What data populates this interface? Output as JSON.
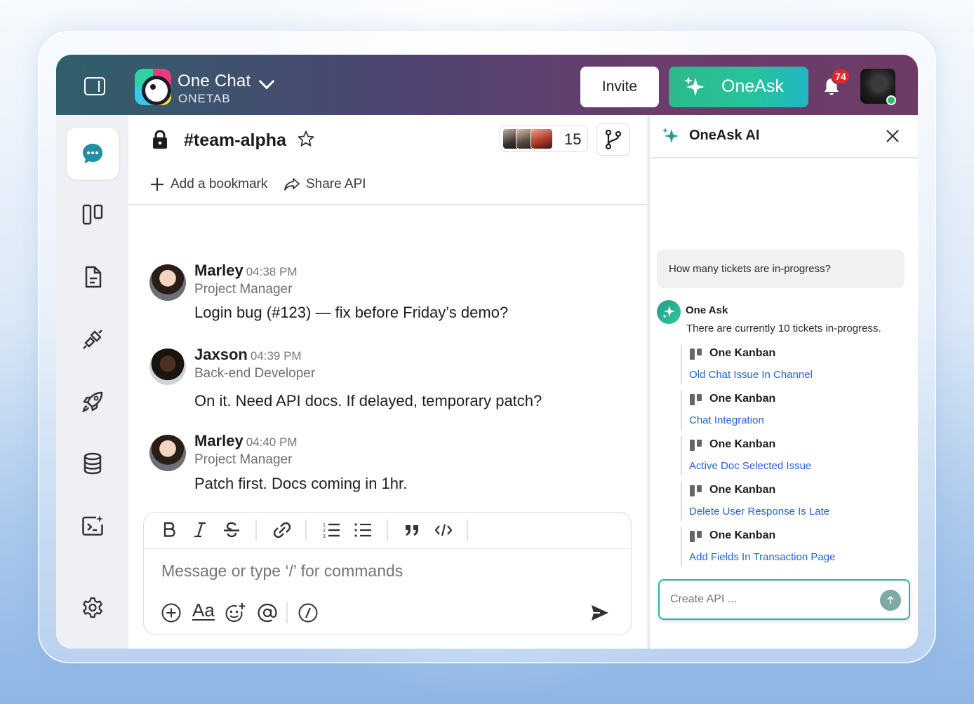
{
  "header": {
    "app_name": "One Chat",
    "workspace": "ONETAB",
    "invite_label": "Invite",
    "oneask_label": "OneAsk",
    "notification_count": "74"
  },
  "rail": {
    "items": [
      "chat-icon",
      "kanban-icon",
      "document-icon",
      "integration-icon",
      "rocket-icon",
      "database-icon",
      "ai-terminal-icon",
      "settings-icon"
    ]
  },
  "channel": {
    "name": "#team-alpha",
    "member_count": "15",
    "bookmark_label": "Add a bookmark",
    "share_label": "Share API"
  },
  "messages": [
    {
      "name": "Marley",
      "time": "04:38 PM",
      "role": "Project Manager",
      "text": "Login bug (#123) — fix before Friday’s demo?"
    },
    {
      "name": "Jaxson",
      "time": "04:39 PM",
      "role": "Back-end Developer",
      "text": "On it. Need API docs. If delayed, temporary patch?"
    },
    {
      "name": "Marley",
      "time": "04:40 PM",
      "role": "Project Manager",
      "text": "Patch first. Docs coming in 1hr."
    }
  ],
  "composer": {
    "placeholder": "Message or type ‘/’ for commands",
    "text_format_label": "Aa"
  },
  "assistant": {
    "title": "OneAsk AI",
    "question": "How many tickets are in-progress?",
    "bot_name": "One Ask",
    "reply": "There are currently 10 tickets in-progress.",
    "tickets": [
      {
        "source": "One Kanban",
        "title": "Old Chat Issue In Channel"
      },
      {
        "source": "One Kanban",
        "title": "Chat Integration"
      },
      {
        "source": "One Kanban",
        "title": "Active Doc Selected Issue"
      },
      {
        "source": "One Kanban",
        "title": "Delete User Response Is Late"
      },
      {
        "source": "One Kanban",
        "title": "Add Fields In Transaction Page"
      }
    ],
    "input_placeholder": "Create API ..."
  },
  "colors": {
    "accent_teal": "#27b5a3",
    "link_blue": "#2563d6",
    "badge_red": "#e3262b"
  }
}
